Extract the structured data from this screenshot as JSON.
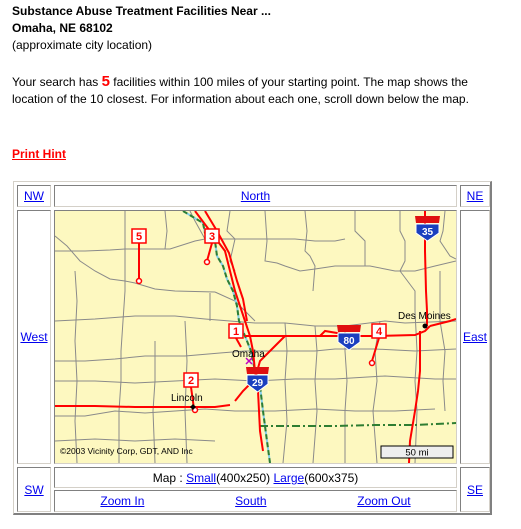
{
  "header": {
    "title": "Substance Abuse Treatment Facilities Near ...",
    "city": "Omaha, NE 68102",
    "note": "(approximate city location)"
  },
  "summary": {
    "prefix": "Your search has ",
    "count": "5",
    "suffix": " facilities within 100 miles of your starting point. The map shows the location of the 10 closest. For information about each one, scroll down below the map."
  },
  "print_hint": "Print Hint",
  "nav": {
    "nw": "NW",
    "north": "North",
    "ne": "NE",
    "west": "West",
    "east": "East",
    "sw": "SW",
    "se": "SE",
    "south": "South",
    "zoom_in": "Zoom In",
    "zoom_out": "Zoom Out",
    "map_size_label": "Map : ",
    "small_label": "Small",
    "small_dims": "(400x250)",
    "large_label": "Large",
    "large_dims": "(600x375)"
  },
  "map": {
    "copyright": "©2003 Vicinity Corp, GDT, AND Inc",
    "scale": "50 mi",
    "colors": {
      "background": "#fdf8c0",
      "road": "#ff0000",
      "county_line": "#808080",
      "state_line": "#2e7d32",
      "water": "#87ceeb",
      "shield_blue": "#1a3fbf",
      "shield_red": "#e01010"
    },
    "cities": [
      {
        "name": "Omaha"
      },
      {
        "name": "Lincoln"
      },
      {
        "name": "Des Moines"
      }
    ],
    "interstates": [
      "35",
      "80",
      "29"
    ],
    "markers": [
      "1",
      "2",
      "3",
      "4",
      "5"
    ]
  }
}
